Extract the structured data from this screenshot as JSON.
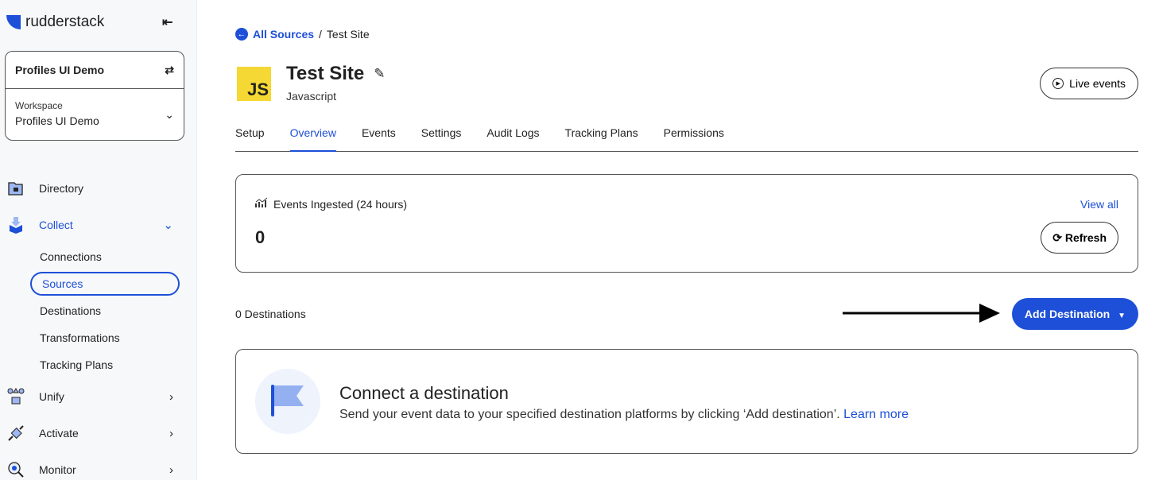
{
  "brand": {
    "name": "rudderstack"
  },
  "workspace": {
    "org": "Profiles UI Demo",
    "label": "Workspace",
    "value": "Profiles UI Demo"
  },
  "nav": {
    "directory": "Directory",
    "collect": "Collect",
    "subs": [
      "Connections",
      "Sources",
      "Destinations",
      "Transformations",
      "Tracking Plans"
    ],
    "unify": "Unify",
    "activate": "Activate",
    "monitor": "Monitor"
  },
  "breadcrumb": {
    "link": "All Sources",
    "sep": "/",
    "current": "Test Site"
  },
  "source": {
    "badge": "JS",
    "title": "Test Site",
    "type": "Javascript"
  },
  "live_events": "Live events",
  "tabs": [
    "Setup",
    "Overview",
    "Events",
    "Settings",
    "Audit Logs",
    "Tracking Plans",
    "Permissions"
  ],
  "active_tab": "Overview",
  "events": {
    "label": "Events Ingested (24 hours)",
    "value": "0",
    "view_all": "View all",
    "refresh": "Refresh"
  },
  "destinations": {
    "count": "0 Destinations",
    "add": "Add Destination"
  },
  "empty": {
    "title": "Connect a destination",
    "desc": "Send your event data to your specified destination platforms by clicking ‘Add destination’.",
    "link": "Learn more"
  },
  "colors": {
    "accent": "#1d4fd8",
    "js_yellow": "#f5d833"
  }
}
